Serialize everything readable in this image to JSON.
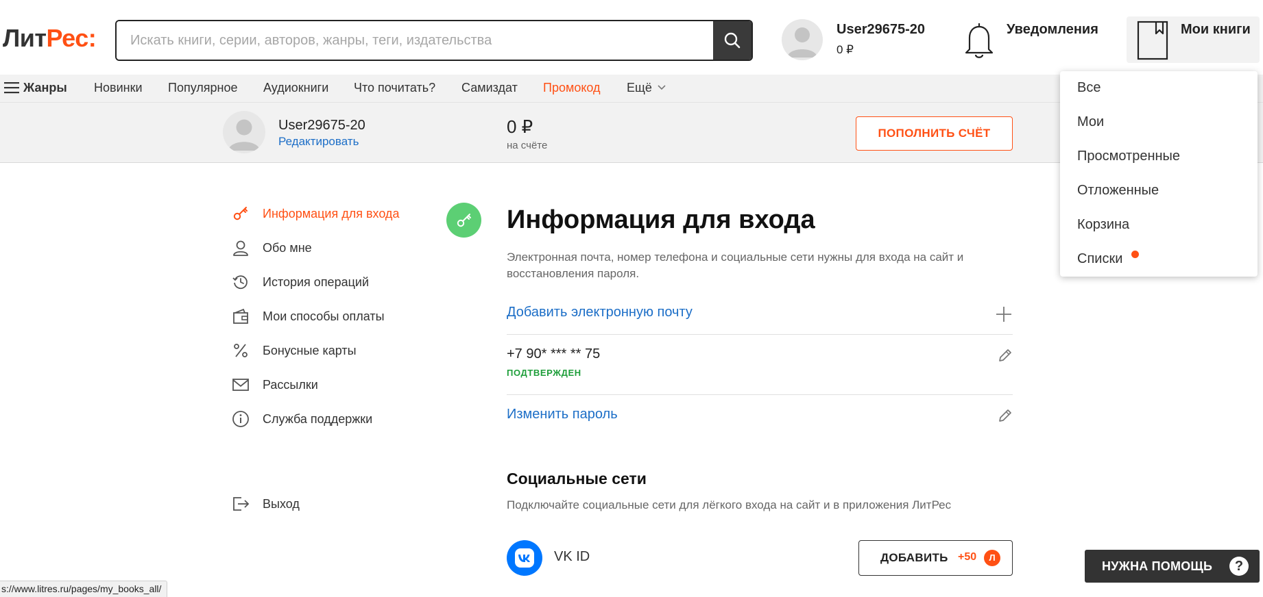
{
  "header": {
    "logo_part1": "Лит",
    "logo_part2": "Рес:",
    "search_placeholder": "Искать книги, серии, авторов, жанры, теги, издательства",
    "search_icon": "search-icon",
    "user_name": "User29675-20",
    "user_balance": "0 ₽",
    "notifications_label": "Уведомления",
    "my_books_label": "Мои книги"
  },
  "nav": {
    "genres": "Жанры",
    "items": [
      "Новинки",
      "Популярное",
      "Аудиокниги",
      "Что почитать?",
      "Самиздат",
      "Промокод",
      "Ещё"
    ]
  },
  "account": {
    "name": "User29675-20",
    "edit_link": "Редактировать",
    "balance_value": "0 ₽",
    "balance_caption": "на счёте",
    "topup_button": "ПОПОЛНИТЬ СЧЁТ"
  },
  "sidebar": {
    "items": [
      {
        "label": "Информация для входа",
        "icon": "key-icon",
        "active": true
      },
      {
        "label": "Обо мне",
        "icon": "user-icon",
        "active": false
      },
      {
        "label": "История операций",
        "icon": "history-icon",
        "active": false
      },
      {
        "label": "Мои способы оплаты",
        "icon": "wallet-icon",
        "active": false
      },
      {
        "label": "Бонусные карты",
        "icon": "percent-icon",
        "active": false
      },
      {
        "label": "Рассылки",
        "icon": "mail-icon",
        "active": false
      },
      {
        "label": "Служба поддержки",
        "icon": "info-icon",
        "active": false
      }
    ],
    "logout": "Выход"
  },
  "main": {
    "title": "Информация для входа",
    "description": "Электронная почта, номер телефона и социальные сети нужны для входа на сайт и восстановления пароля.",
    "add_email": "Добавить электронную почту",
    "phone": "+7 90* *** ** 75",
    "phone_status": "ПОДТВЕРЖДЕН",
    "change_password": "Изменить пароль",
    "social_title": "Социальные сети",
    "social_description": "Подключайте социальные сети для лёгкого входа на сайт и в приложения ЛитРес",
    "vk_label": "VK ID",
    "add_button": "ДОБАВИТЬ",
    "add_bonus": "+50",
    "add_badge": "Л"
  },
  "dropdown": {
    "items": [
      "Все",
      "Мои",
      "Просмотренные",
      "Отложенные",
      "Корзина",
      "Списки"
    ]
  },
  "help_button": {
    "label": "НУЖНА ПОМОЩЬ",
    "icon": "?"
  },
  "status_bar": {
    "url": "s://www.litres.ru/pages/my_books_all/"
  },
  "colors": {
    "accent": "#ff5014",
    "link": "#1c6ec7",
    "verified": "#1e9e3a",
    "key_circle": "#5ccf74",
    "vk": "#0077ff"
  }
}
